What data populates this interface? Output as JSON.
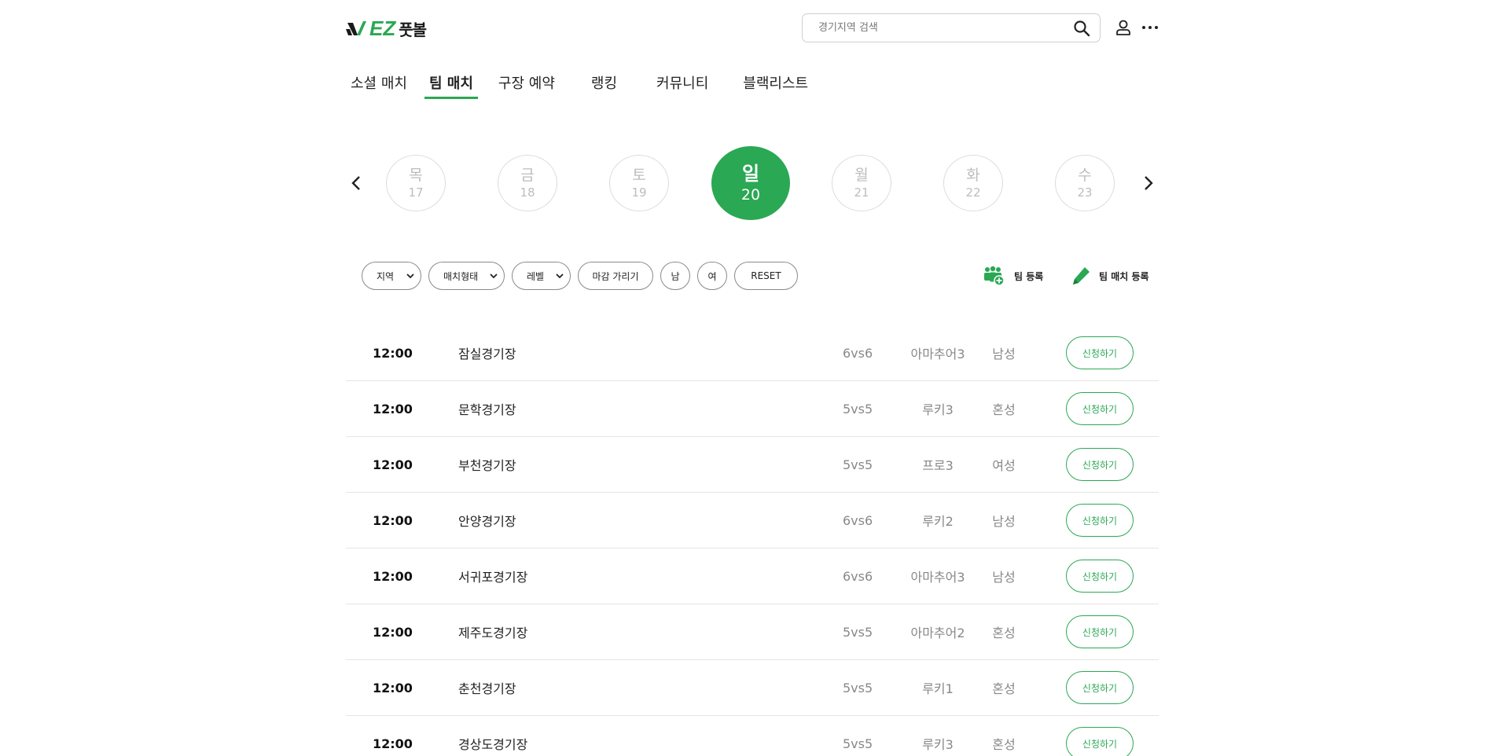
{
  "brand": {
    "logo_en": "EZ",
    "logo_kr": "풋볼",
    "accent": "#2aa853"
  },
  "search": {
    "placeholder": "경기지역 검색"
  },
  "icons": {
    "search": "search-icon",
    "user": "user-icon",
    "more": "more-icon",
    "prev": "chevron-left-icon",
    "next": "chevron-right-icon",
    "team": "team-add-icon",
    "match": "pencil-icon"
  },
  "nav": {
    "items": [
      {
        "label": "소셜 매치"
      },
      {
        "label": "팀 매치"
      },
      {
        "label": "구장 예약"
      },
      {
        "label": "랭킹"
      },
      {
        "label": "커뮤니티"
      },
      {
        "label": "블랙리스트"
      }
    ],
    "active_index": 1
  },
  "dates": [
    {
      "dow": "목",
      "day": "17"
    },
    {
      "dow": "금",
      "day": "18"
    },
    {
      "dow": "토",
      "day": "19"
    },
    {
      "dow": "일",
      "day": "20"
    },
    {
      "dow": "월",
      "day": "21"
    },
    {
      "dow": "화",
      "day": "22"
    },
    {
      "dow": "수",
      "day": "23"
    }
  ],
  "selected_date_index": 3,
  "filters": {
    "region": "지역",
    "match_type": "매치형태",
    "level": "레벨",
    "hide_closed": "마감 가리기",
    "male": "남",
    "female": "여",
    "reset": "RESET"
  },
  "actions": {
    "register_team": "팀 등록",
    "register_match": "팀 매치 등록"
  },
  "matches": [
    {
      "time": "12:00",
      "stadium": "잠실경기장",
      "format": "6vs6",
      "level": "아마추어3",
      "gender": "남성",
      "action": "신청하기"
    },
    {
      "time": "12:00",
      "stadium": "문학경기장",
      "format": "5vs5",
      "level": "루키3",
      "gender": "혼성",
      "action": "신청하기"
    },
    {
      "time": "12:00",
      "stadium": "부천경기장",
      "format": "5vs5",
      "level": "프로3",
      "gender": "여성",
      "action": "신청하기"
    },
    {
      "time": "12:00",
      "stadium": "안양경기장",
      "format": "6vs6",
      "level": "루키2",
      "gender": "남성",
      "action": "신청하기"
    },
    {
      "time": "12:00",
      "stadium": "서귀포경기장",
      "format": "6vs6",
      "level": "아마추어3",
      "gender": "남성",
      "action": "신청하기"
    },
    {
      "time": "12:00",
      "stadium": "제주도경기장",
      "format": "5vs5",
      "level": "아마추어2",
      "gender": "혼성",
      "action": "신청하기"
    },
    {
      "time": "12:00",
      "stadium": "춘천경기장",
      "format": "5vs5",
      "level": "루키1",
      "gender": "혼성",
      "action": "신청하기"
    },
    {
      "time": "12:00",
      "stadium": "경상도경기장",
      "format": "5vs5",
      "level": "루키3",
      "gender": "혼성",
      "action": "신청하기"
    }
  ]
}
